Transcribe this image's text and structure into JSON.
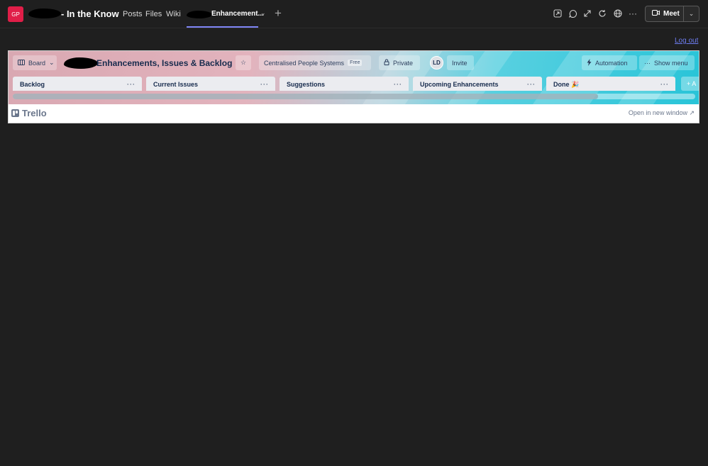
{
  "teams": {
    "avatar_initials": "GP",
    "team_title_suffix": "- In the Know",
    "tabs": [
      {
        "label": "Posts"
      },
      {
        "label": "Files"
      },
      {
        "label": "Wiki"
      },
      {
        "label": "Enhancement..."
      }
    ],
    "add_tab_glyph": "+",
    "meet_label": "Meet",
    "colors": {
      "background": "#1f1f1f",
      "accent": "#7f85f5",
      "avatar": "#e01e48",
      "link": "#6d7df0"
    }
  },
  "logout_label": "Log out",
  "board": {
    "view_label": "Board",
    "title_suffix": "Enhancements, Issues & Backlog",
    "workspace_label": "Centralised People Systems",
    "workspace_badge": "Free",
    "visibility_label": "Private",
    "member_initials": "LD",
    "invite_label": "Invite",
    "automation_label": "Automation",
    "show_menu_label": "Show menu",
    "lists": [
      {
        "title": "Backlog"
      },
      {
        "title": "Current Issues"
      },
      {
        "title": "Suggestions"
      },
      {
        "title": "Upcoming Enhancements"
      },
      {
        "title": "Done 🎉"
      }
    ],
    "list_menu_glyph": "···",
    "add_list_label": "+ A"
  },
  "footer": {
    "brand": "Trello",
    "open_new_window": "Open in new window ↗"
  }
}
